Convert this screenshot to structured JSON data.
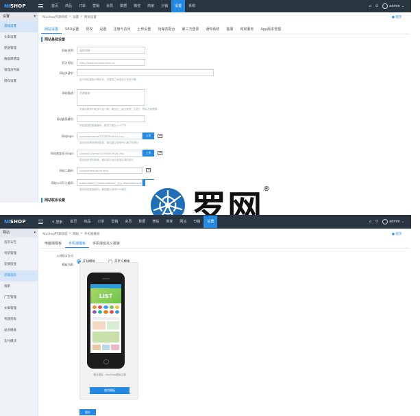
{
  "top": {
    "logo_prefix": "NI",
    "logo_suffix": "SHOP",
    "nav": [
      "首页",
      "商品",
      "订单",
      "营销",
      "会员",
      "数据",
      "微信",
      "商家",
      "分销",
      "设置",
      "系统"
    ],
    "active_nav": "设置",
    "user": "admin"
  },
  "top2": {
    "search": "搜索",
    "nav": [
      "首页",
      "商品",
      "订单",
      "营销",
      "会员",
      "数据",
      "微信",
      "商家",
      "网站",
      "分销",
      "设置"
    ],
    "user": "admin"
  },
  "sidebar1": {
    "title": "设置",
    "items": [
      "基础设置",
      "文章设置",
      "配送管理",
      "数据库管理",
      "管理员列表",
      "授权设置"
    ]
  },
  "sidebar2": {
    "title": "网站",
    "items": [
      "首页公告",
      "导航管理",
      "友情链接",
      "店铺首页",
      "搜索",
      "广告管理",
      "文章管理",
      "专题列表",
      "站点模板",
      "支付模块"
    ]
  },
  "crumb1": [
    "Niushop开源商城",
    "设置",
    "网站设置"
  ],
  "crumb2": [
    "Niushop开源商城",
    "网站",
    "手机端模板"
  ],
  "help": "提示",
  "tabs1": [
    "网站设置",
    "SEO设置",
    "授权",
    "设置",
    "注册与访问",
    "上传设置",
    "伪静态配合",
    "第三方登录",
    "通知系统",
    "客服",
    "商家服务",
    "App版本管理"
  ],
  "section1": "网站基础设置",
  "section2": "网站联系设置",
  "form": [
    {
      "label": "网站名称:",
      "value": "或用官网",
      "width": 100
    },
    {
      "label": "官方网址:",
      "value": "http://www.niushop.com.cn",
      "width": 100
    },
    {
      "label": "网站关键字:",
      "value": "",
      "width": 200,
      "hint": "用于网站搜索引擎优化，关键字之间用英文逗号分隔"
    },
    {
      "label": "网站描述:",
      "value": "开源商城",
      "width": 100,
      "tall": true,
      "hint": "关键字要求不能多于这个数，建议在二级分类里，比如?，等后方面需要"
    },
    {
      "label": "网站备案编号:",
      "value": "",
      "width": 100,
      "hint": "网站底部的备案编号，最多不超过十六个字"
    },
    {
      "label": "网站logo:",
      "value": "upload/common/1506004924.png",
      "width": 96,
      "upload": true,
      "hint": "建议使用黑底透明背景，最佳建议使用PNG格式的图片"
    },
    {
      "label": "网站底部显示logo:",
      "value": "upload/common/1506004926.png",
      "width": 96,
      "upload": true,
      "hint": "建议使用透明背景，最佳建议适合底部区域的图片"
    },
    {
      "label": "网站二维码:",
      "value": "upload/qrcode/url.png",
      "width": 96,
      "icon_only": true
    },
    {
      "label": "网站公众号二维码:",
      "value": "public/static/images/default_img_wxpicode.png",
      "width": 96,
      "upload": true,
      "hint": "建议使用宽高相同，最佳建议使用PNG格式"
    }
  ],
  "upload_label": "上传",
  "tabs2": [
    "电脑端模板",
    "手机端模板",
    "手机端自定义模板"
  ],
  "template": {
    "label": "公测显示方式:",
    "opt1": "在线模板",
    "opt2": "自定义模板",
    "list_label": "模板列表:",
    "caption": "默认模板 - NiuShop模板主题",
    "use_btn": "使用模板",
    "save_btn": "保存",
    "phone_banner": "LIST"
  },
  "watermark": {
    "text": "罗网",
    "reg": "®"
  },
  "colors": {
    "accent": "#2389e2",
    "topbar": "#2a3542",
    "sidebar": "#eef1f5"
  }
}
